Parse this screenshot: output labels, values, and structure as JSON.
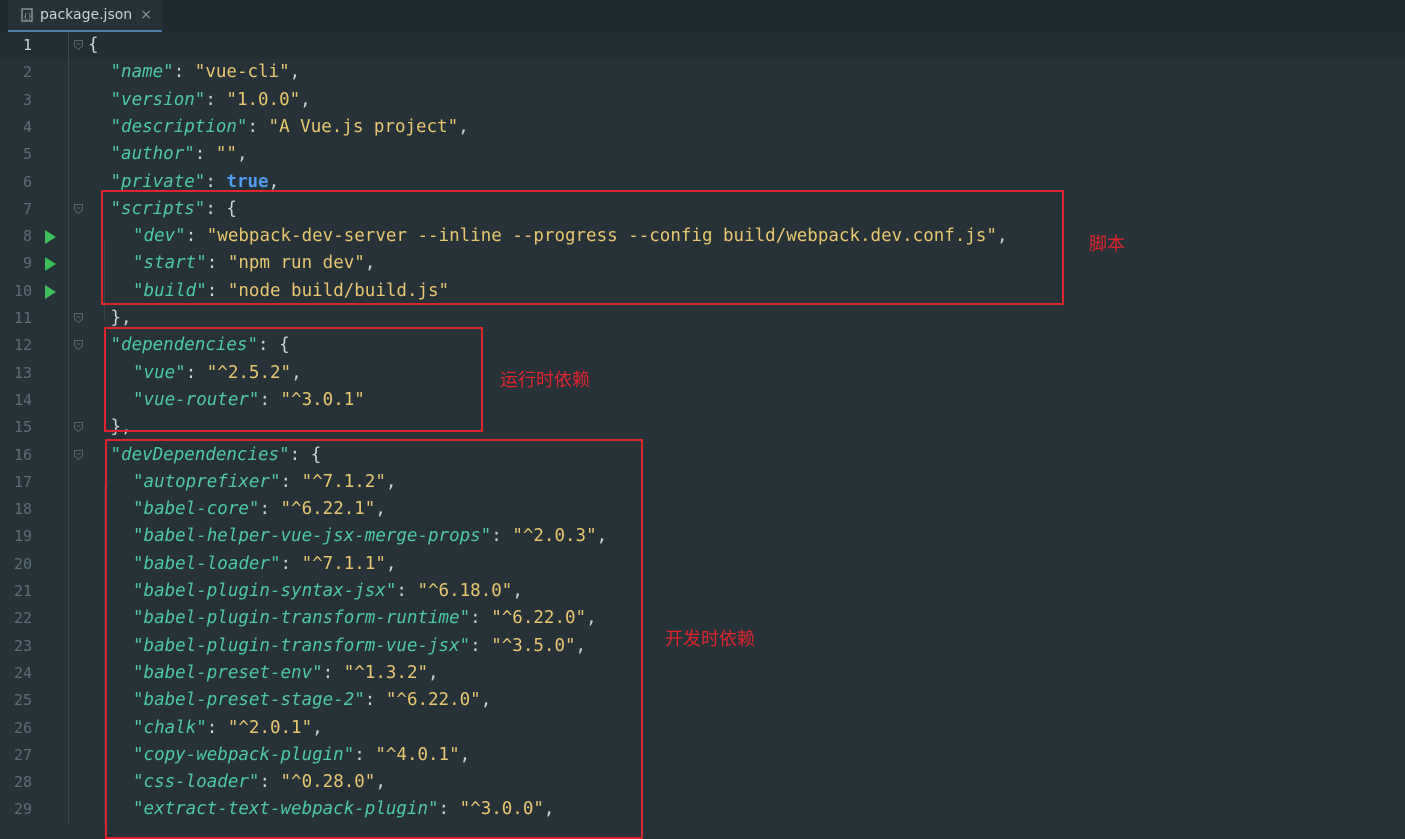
{
  "tab": {
    "label": "package.json",
    "close": "×"
  },
  "lines": [
    {
      "n": "1",
      "fold": true,
      "run": false,
      "ind": 0,
      "parts": [
        [
          "p",
          "{"
        ]
      ]
    },
    {
      "n": "2",
      "fold": false,
      "run": false,
      "ind": 1,
      "parts": [
        [
          "k",
          "\"name\""
        ],
        [
          "p",
          ": "
        ],
        [
          "s",
          "\"vue-cli\""
        ],
        [
          "p",
          ","
        ]
      ]
    },
    {
      "n": "3",
      "fold": false,
      "run": false,
      "ind": 1,
      "parts": [
        [
          "k",
          "\"version\""
        ],
        [
          "p",
          ": "
        ],
        [
          "s",
          "\"1.0.0\""
        ],
        [
          "p",
          ","
        ]
      ]
    },
    {
      "n": "4",
      "fold": false,
      "run": false,
      "ind": 1,
      "parts": [
        [
          "k",
          "\"description\""
        ],
        [
          "p",
          ": "
        ],
        [
          "s",
          "\"A Vue.js project\""
        ],
        [
          "p",
          ","
        ]
      ]
    },
    {
      "n": "5",
      "fold": false,
      "run": false,
      "ind": 1,
      "parts": [
        [
          "k",
          "\"author\""
        ],
        [
          "p",
          ": "
        ],
        [
          "s",
          "\"\""
        ],
        [
          "p",
          ","
        ]
      ]
    },
    {
      "n": "6",
      "fold": false,
      "run": false,
      "ind": 1,
      "parts": [
        [
          "k",
          "\"private\""
        ],
        [
          "p",
          ": "
        ],
        [
          "b",
          "true"
        ],
        [
          "p",
          ","
        ]
      ]
    },
    {
      "n": "7",
      "fold": true,
      "run": false,
      "ind": 1,
      "parts": [
        [
          "k",
          "\"scripts\""
        ],
        [
          "p",
          ": {"
        ]
      ]
    },
    {
      "n": "8",
      "fold": false,
      "run": true,
      "ind": 2,
      "parts": [
        [
          "k",
          "\"dev\""
        ],
        [
          "p",
          ": "
        ],
        [
          "s",
          "\"webpack-dev-server --inline --progress --config build/webpack.dev.conf.js\""
        ],
        [
          "p",
          ","
        ]
      ]
    },
    {
      "n": "9",
      "fold": false,
      "run": true,
      "ind": 2,
      "parts": [
        [
          "k",
          "\"start\""
        ],
        [
          "p",
          ": "
        ],
        [
          "s",
          "\"npm run dev\""
        ],
        [
          "p",
          ","
        ]
      ]
    },
    {
      "n": "10",
      "fold": false,
      "run": true,
      "ind": 2,
      "parts": [
        [
          "k",
          "\"build\""
        ],
        [
          "p",
          ": "
        ],
        [
          "s",
          "\"node build/build.js\""
        ]
      ]
    },
    {
      "n": "11",
      "fold": true,
      "run": false,
      "ind": 1,
      "parts": [
        [
          "p",
          "},"
        ]
      ]
    },
    {
      "n": "12",
      "fold": true,
      "run": false,
      "ind": 1,
      "parts": [
        [
          "k",
          "\"dependencies\""
        ],
        [
          "p",
          ": {"
        ]
      ]
    },
    {
      "n": "13",
      "fold": false,
      "run": false,
      "ind": 2,
      "parts": [
        [
          "k",
          "\"vue\""
        ],
        [
          "p",
          ": "
        ],
        [
          "s",
          "\"^2.5.2\""
        ],
        [
          "p",
          ","
        ]
      ]
    },
    {
      "n": "14",
      "fold": false,
      "run": false,
      "ind": 2,
      "parts": [
        [
          "k",
          "\"vue-router\""
        ],
        [
          "p",
          ": "
        ],
        [
          "s",
          "\"^3.0.1\""
        ]
      ]
    },
    {
      "n": "15",
      "fold": true,
      "run": false,
      "ind": 1,
      "parts": [
        [
          "p",
          "},"
        ]
      ]
    },
    {
      "n": "16",
      "fold": true,
      "run": false,
      "ind": 1,
      "parts": [
        [
          "k",
          "\"devDependencies\""
        ],
        [
          "p",
          ": {"
        ]
      ]
    },
    {
      "n": "17",
      "fold": false,
      "run": false,
      "ind": 2,
      "parts": [
        [
          "k",
          "\"autoprefixer\""
        ],
        [
          "p",
          ": "
        ],
        [
          "s",
          "\"^7.1.2\""
        ],
        [
          "p",
          ","
        ]
      ]
    },
    {
      "n": "18",
      "fold": false,
      "run": false,
      "ind": 2,
      "parts": [
        [
          "k",
          "\"babel-core\""
        ],
        [
          "p",
          ": "
        ],
        [
          "s",
          "\"^6.22.1\""
        ],
        [
          "p",
          ","
        ]
      ]
    },
    {
      "n": "19",
      "fold": false,
      "run": false,
      "ind": 2,
      "parts": [
        [
          "k",
          "\"babel-helper-vue-jsx-merge-props\""
        ],
        [
          "p",
          ": "
        ],
        [
          "s",
          "\"^2.0.3\""
        ],
        [
          "p",
          ","
        ]
      ]
    },
    {
      "n": "20",
      "fold": false,
      "run": false,
      "ind": 2,
      "parts": [
        [
          "k",
          "\"babel-loader\""
        ],
        [
          "p",
          ": "
        ],
        [
          "s",
          "\"^7.1.1\""
        ],
        [
          "p",
          ","
        ]
      ]
    },
    {
      "n": "21",
      "fold": false,
      "run": false,
      "ind": 2,
      "parts": [
        [
          "k",
          "\"babel-plugin-syntax-jsx\""
        ],
        [
          "p",
          ": "
        ],
        [
          "s",
          "\"^6.18.0\""
        ],
        [
          "p",
          ","
        ]
      ]
    },
    {
      "n": "22",
      "fold": false,
      "run": false,
      "ind": 2,
      "parts": [
        [
          "k",
          "\"babel-plugin-transform-runtime\""
        ],
        [
          "p",
          ": "
        ],
        [
          "s",
          "\"^6.22.0\""
        ],
        [
          "p",
          ","
        ]
      ]
    },
    {
      "n": "23",
      "fold": false,
      "run": false,
      "ind": 2,
      "parts": [
        [
          "k",
          "\"babel-plugin-transform-vue-jsx\""
        ],
        [
          "p",
          ": "
        ],
        [
          "s",
          "\"^3.5.0\""
        ],
        [
          "p",
          ","
        ]
      ]
    },
    {
      "n": "24",
      "fold": false,
      "run": false,
      "ind": 2,
      "parts": [
        [
          "k",
          "\"babel-preset-env\""
        ],
        [
          "p",
          ": "
        ],
        [
          "s",
          "\"^1.3.2\""
        ],
        [
          "p",
          ","
        ]
      ]
    },
    {
      "n": "25",
      "fold": false,
      "run": false,
      "ind": 2,
      "parts": [
        [
          "k",
          "\"babel-preset-stage-2\""
        ],
        [
          "p",
          ": "
        ],
        [
          "s",
          "\"^6.22.0\""
        ],
        [
          "p",
          ","
        ]
      ]
    },
    {
      "n": "26",
      "fold": false,
      "run": false,
      "ind": 2,
      "parts": [
        [
          "k",
          "\"chalk\""
        ],
        [
          "p",
          ": "
        ],
        [
          "s",
          "\"^2.0.1\""
        ],
        [
          "p",
          ","
        ]
      ]
    },
    {
      "n": "27",
      "fold": false,
      "run": false,
      "ind": 2,
      "parts": [
        [
          "k",
          "\"copy-webpack-plugin\""
        ],
        [
          "p",
          ": "
        ],
        [
          "s",
          "\"^4.0.1\""
        ],
        [
          "p",
          ","
        ]
      ]
    },
    {
      "n": "28",
      "fold": false,
      "run": false,
      "ind": 2,
      "parts": [
        [
          "k",
          "\"css-loader\""
        ],
        [
          "p",
          ": "
        ],
        [
          "s",
          "\"^0.28.0\""
        ],
        [
          "p",
          ","
        ]
      ]
    },
    {
      "n": "29",
      "fold": false,
      "run": false,
      "ind": 2,
      "parts": [
        [
          "k",
          "\"extract-text-webpack-plugin\""
        ],
        [
          "p",
          ": "
        ],
        [
          "s",
          "\"^3.0.0\""
        ],
        [
          "p",
          ","
        ]
      ]
    }
  ],
  "annotations": {
    "scripts": "脚本",
    "dependencies": "运行时依赖",
    "devDependencies": "开发时依赖"
  },
  "colors": {
    "key": "#4ec9a4",
    "string": "#e8c76e",
    "boolean": "#4f9cf0",
    "annotation": "#e0242e",
    "run": "#3fbf5a"
  }
}
